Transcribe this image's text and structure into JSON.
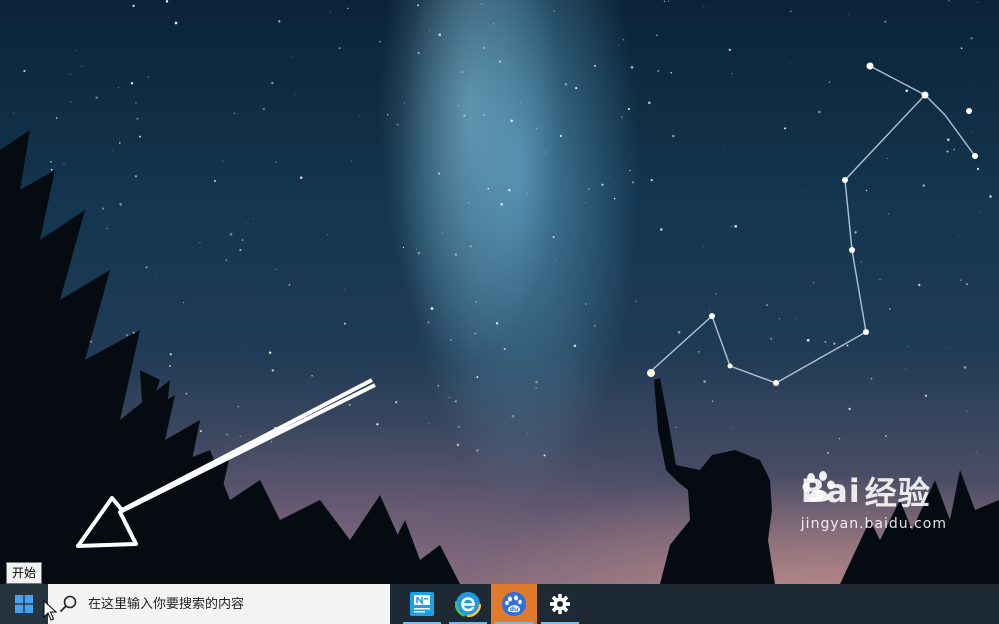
{
  "tooltip": {
    "text": "开始"
  },
  "taskbar": {
    "search": {
      "placeholder": "在这里输入你要搜索的内容"
    },
    "apps": [
      {
        "icon": "news-app-icon",
        "running": true
      },
      {
        "icon": "browser-e-icon",
        "running": true
      },
      {
        "icon": "baidu-icon",
        "running": true,
        "active": true
      },
      {
        "icon": "gear-icon",
        "running": true
      }
    ]
  },
  "watermark": {
    "brand_latin": "Bai",
    "brand_tail": "经验",
    "url": "jingyan.baidu.com"
  },
  "colors": {
    "taskbar": "#1d2a33",
    "search_box": "#f3f3f3",
    "active_app": "#e07a2c",
    "running_indicator": "#7fb9e6"
  }
}
